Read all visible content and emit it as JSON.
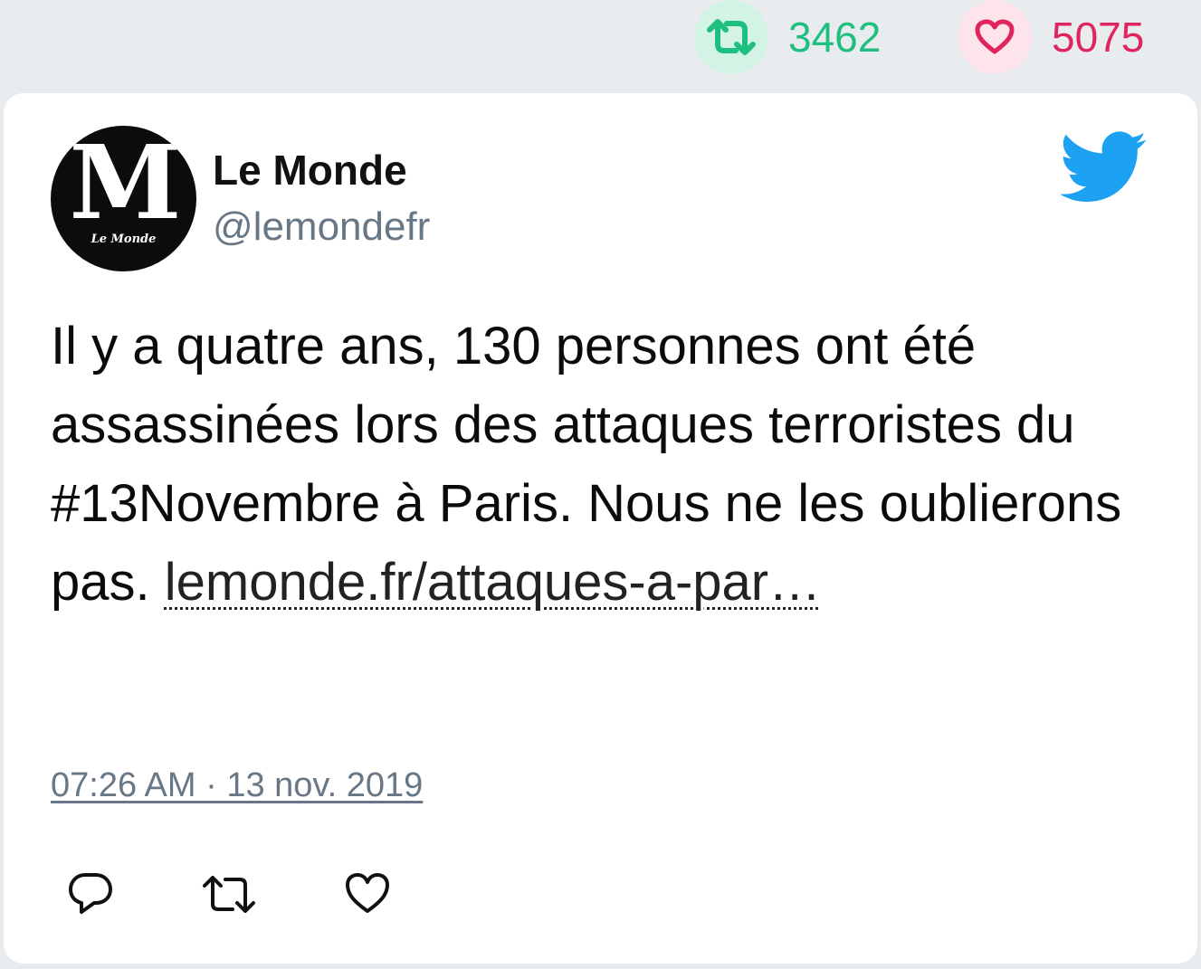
{
  "stats": {
    "retweets": "3462",
    "likes": "5075",
    "retweet_icon": "retweet-icon",
    "like_icon": "heart-icon",
    "retweet_color": "#1fbf7f",
    "like_color": "#e0245e"
  },
  "tweet": {
    "display_name": "Le Monde",
    "handle": "@lemondefr",
    "avatar_letter": "M",
    "avatar_caption": "Le Monde",
    "text_before_link": "Il y a quatre ans, 130 personnes ont été assassinées lors des attaques terroristes du #13Novembre à Paris. Nous ne les oublierons pas. ",
    "link_text": "lemonde.fr/attaques-a-par…",
    "timestamp": "07:26 AM · 13 nov. 2019",
    "brand_icon": "twitter-bird-icon",
    "brand_color": "#1da1f2"
  },
  "actions": {
    "reply_icon": "reply-icon",
    "retweet_icon": "retweet-icon",
    "like_icon": "heart-icon"
  }
}
